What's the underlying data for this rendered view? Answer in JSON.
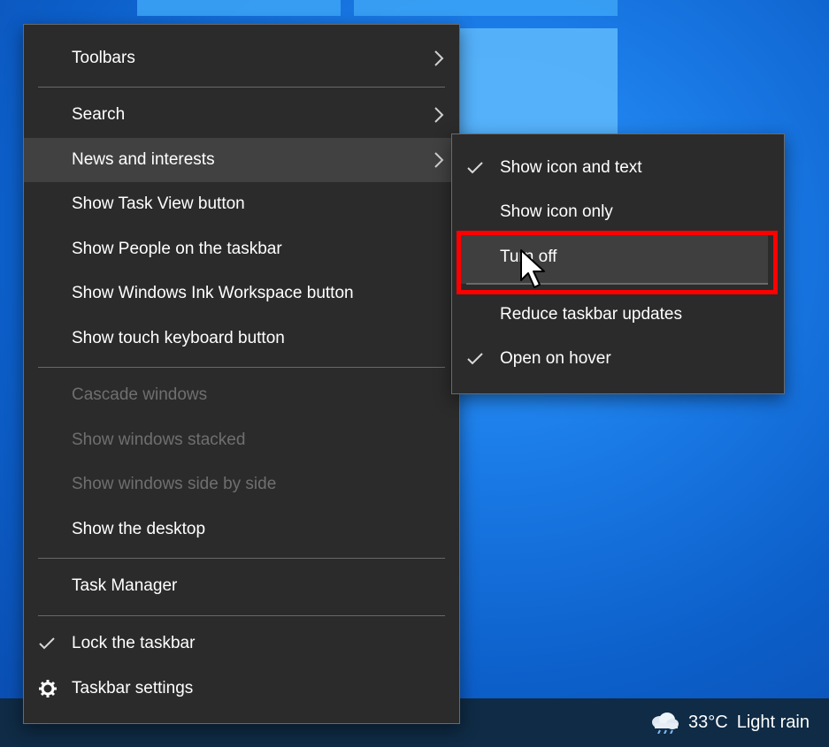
{
  "main_menu": {
    "items": [
      {
        "label": "Toolbars"
      },
      {
        "label": "Search"
      },
      {
        "label": "News and interests"
      },
      {
        "label": "Show Task View button"
      },
      {
        "label": "Show People on the taskbar"
      },
      {
        "label": "Show Windows Ink Workspace button"
      },
      {
        "label": "Show touch keyboard button"
      },
      {
        "label": "Cascade windows"
      },
      {
        "label": "Show windows stacked"
      },
      {
        "label": "Show windows side by side"
      },
      {
        "label": "Show the desktop"
      },
      {
        "label": "Task Manager"
      },
      {
        "label": "Lock the taskbar"
      },
      {
        "label": "Taskbar settings"
      }
    ]
  },
  "sub_menu": {
    "items": [
      {
        "label": "Show icon and text"
      },
      {
        "label": "Show icon only"
      },
      {
        "label": "Turn off"
      },
      {
        "label": "Reduce taskbar updates"
      },
      {
        "label": "Open on hover"
      }
    ]
  },
  "taskbar": {
    "weather_temp": "33°C",
    "weather_desc": "Light rain"
  },
  "icons": {
    "chevron": "chevron-right-icon",
    "check": "checkmark-icon",
    "gear": "gear-icon",
    "weather": "rain-cloud-icon",
    "cursor": "mouse-pointer-icon"
  },
  "colors": {
    "menu_bg": "#2b2b2b",
    "menu_hover": "#414141",
    "disabled_text": "#6f6f6f",
    "highlight_box": "#ff0000",
    "taskbar": "#0f2b45"
  }
}
